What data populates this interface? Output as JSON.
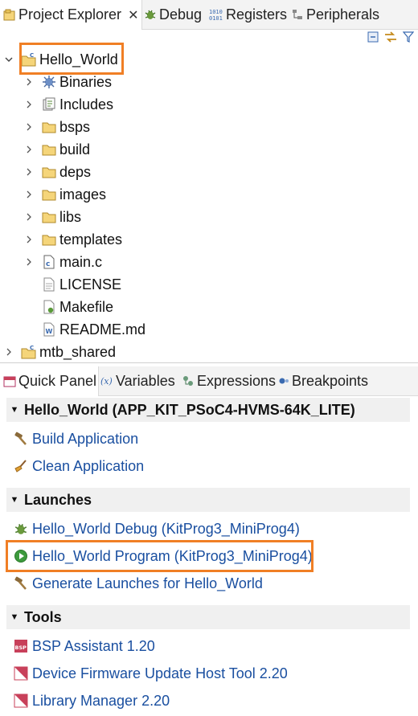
{
  "top_tabs": [
    {
      "label": "Project Explorer",
      "icon": "project-explorer-icon",
      "active": true,
      "closable": true
    },
    {
      "label": "Debug",
      "icon": "debug-bug-icon"
    },
    {
      "label": "Registers",
      "icon": "registers-binary-icon"
    },
    {
      "label": "Peripherals",
      "icon": "peripherals-icon"
    }
  ],
  "view_toolbar": [
    "collapse-all-icon",
    "link-with-editor-icon",
    "filter-icon"
  ],
  "tree": {
    "root": {
      "label": "Hello_World",
      "expanded": true,
      "highlighted": true
    },
    "children": [
      {
        "label": "Binaries",
        "icon": "binaries-icon",
        "expandable": true
      },
      {
        "label": "Includes",
        "icon": "includes-icon",
        "expandable": true
      },
      {
        "label": "bsps",
        "icon": "folder-icon",
        "expandable": true
      },
      {
        "label": "build",
        "icon": "folder-icon",
        "expandable": true
      },
      {
        "label": "deps",
        "icon": "folder-icon",
        "expandable": true
      },
      {
        "label": "images",
        "icon": "folder-icon",
        "expandable": true
      },
      {
        "label": "libs",
        "icon": "folder-icon",
        "expandable": true
      },
      {
        "label": "templates",
        "icon": "folder-icon",
        "expandable": true
      },
      {
        "label": "main.c",
        "icon": "c-source-file-icon",
        "expandable": true
      },
      {
        "label": "LICENSE",
        "icon": "text-file-icon",
        "expandable": false
      },
      {
        "label": "Makefile",
        "icon": "makefile-icon",
        "expandable": false
      },
      {
        "label": "README.md",
        "icon": "markdown-file-icon",
        "expandable": false
      }
    ],
    "sibling": {
      "label": "mtb_shared",
      "expanded": false
    }
  },
  "bottom_tabs": [
    {
      "label": "Quick Panel",
      "icon": "quick-panel-icon",
      "active": true
    },
    {
      "label": "Variables",
      "icon": "variables-icon"
    },
    {
      "label": "Expressions",
      "icon": "expressions-icon"
    },
    {
      "label": "Breakpoints",
      "icon": "breakpoints-icon"
    }
  ],
  "quick_panel": {
    "project_section": {
      "title": "Hello_World (APP_KIT_PSoC4-HVMS-64K_LITE)",
      "items": [
        {
          "label": "Build Application",
          "icon": "hammer-icon"
        },
        {
          "label": "Clean Application",
          "icon": "broom-icon"
        }
      ]
    },
    "launches_section": {
      "title": "Launches",
      "items": [
        {
          "label": "Hello_World Debug (KitProg3_MiniProg4)",
          "icon": "debug-bug-icon"
        },
        {
          "label": "Hello_World Program (KitProg3_MiniProg4)",
          "icon": "run-play-icon",
          "highlighted": true
        },
        {
          "label": "Generate Launches for Hello_World",
          "icon": "hammer-icon"
        }
      ]
    },
    "tools_section": {
      "title": "Tools",
      "items": [
        {
          "label": "BSP Assistant 1.20",
          "icon": "bsp-assistant-icon",
          "badge": "BSP"
        },
        {
          "label": "Device Firmware Update Host Tool 2.20",
          "icon": "tool-icon"
        },
        {
          "label": "Library Manager 2.20",
          "icon": "tool-icon"
        }
      ]
    }
  },
  "colors": {
    "accent_highlight": "#f07f25",
    "link": "#1a4fa0",
    "folder": "#e8c35a",
    "section_bg": "#f0f0f0"
  }
}
